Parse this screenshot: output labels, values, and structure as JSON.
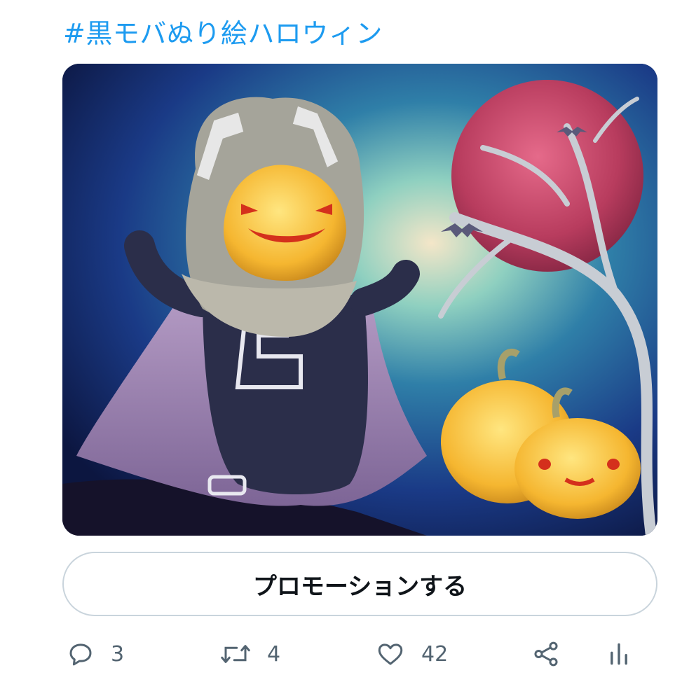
{
  "tweet": {
    "hashtag": "#黒モバぬり絵ハロウィン",
    "promote_label": "プロモーションする"
  },
  "actions": {
    "reply": {
      "icon": "reply-icon",
      "count": "3"
    },
    "retweet": {
      "icon": "retweet-icon",
      "count": "4"
    },
    "like": {
      "icon": "heart-icon",
      "count": "42"
    },
    "share": {
      "icon": "share-icon"
    },
    "analytics": {
      "icon": "analytics-icon"
    }
  },
  "colors": {
    "link": "#1d9bf0",
    "icon_gray": "#536471",
    "button_border": "#c9d4dc",
    "text": "#0f1419"
  }
}
